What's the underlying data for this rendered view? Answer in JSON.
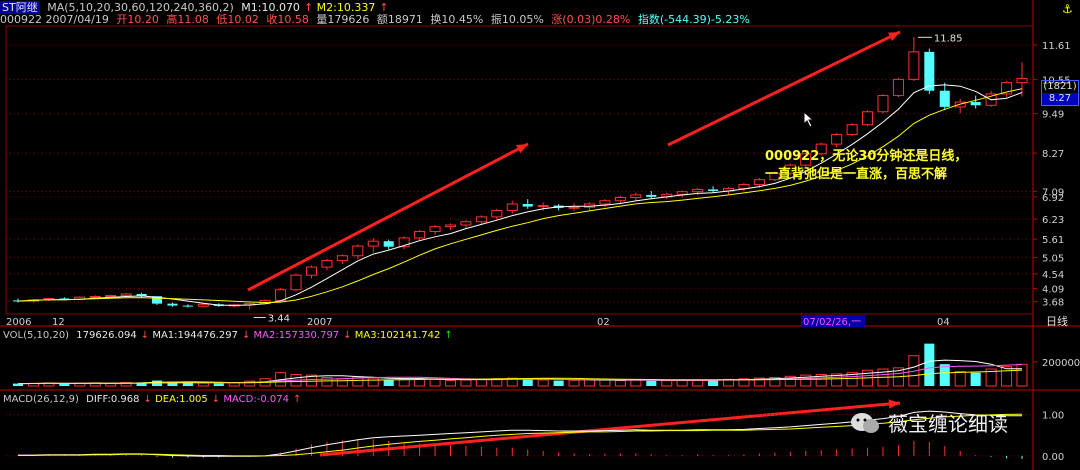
{
  "header": {
    "code": "ST阿继",
    "ma_label": "MA(5,10,20,30,60,120,240,360,2)",
    "m1": "M1:10.070",
    "m2": "M2:10.337",
    "code_date": "000922 2007/04/19",
    "open": "开10.20",
    "high": "高11.08",
    "low": "低10.02",
    "close": "收10.58",
    "vol": "量179626",
    "amount": "额18971",
    "turnover": "换10.45%",
    "amplitude": "振10.05%",
    "change": "涨(0.03)0.28%",
    "index": "指数(-544.39)-5.23%"
  },
  "price_axis": [
    "11.61",
    "10.55",
    "9.49",
    "8.27",
    "7.09",
    "6.92",
    "6.23",
    "5.61",
    "5.05",
    "4.54",
    "4.09",
    "3.68"
  ],
  "price_box": {
    "line1": "(1821)",
    "line2": "8.27"
  },
  "time_axis": {
    "labels": [
      "2006",
      "12",
      "2007",
      "02",
      "07/02/26,一",
      "04"
    ],
    "period": "日线"
  },
  "labels": {
    "high_mark": "11.85",
    "low_mark": "3.44"
  },
  "annotation": {
    "line1": "000922，无论30分钟还是日线，",
    "line2": "一直背弛但是一直涨，百思不解"
  },
  "vol_header": {
    "label": "VOL(5,10,20)",
    "value": "179626.094",
    "ma1": "MA1:194476.297",
    "ma2": "MA2:157330.797",
    "ma3": "MA3:102141.742"
  },
  "vol_axis": [
    "200000"
  ],
  "macd_header": {
    "label": "MACD(26,12,9)",
    "diff": "DIFF:0.968",
    "dea": "DEA:1.005",
    "macd": "MACD:-0.074"
  },
  "macd_axis": [
    "1.00",
    "0.00"
  ],
  "watermark": "薇宝缠论细读",
  "colors": {
    "up": "#ff3030",
    "down": "#55ffff",
    "ma1": "#ffffff",
    "ma2": "#ffff00",
    "ma3": "#ff55ff",
    "arrow": "#ff2020",
    "grid": "#8b0000"
  },
  "chart_data": {
    "type": "candlestick",
    "title": "",
    "ylim": [
      3.3,
      12.2
    ],
    "candles": [
      [
        3.72,
        3.78,
        3.66,
        3.7
      ],
      [
        3.7,
        3.76,
        3.65,
        3.74
      ],
      [
        3.74,
        3.8,
        3.7,
        3.78
      ],
      [
        3.78,
        3.82,
        3.72,
        3.75
      ],
      [
        3.75,
        3.85,
        3.73,
        3.82
      ],
      [
        3.82,
        3.88,
        3.78,
        3.84
      ],
      [
        3.84,
        3.9,
        3.8,
        3.87
      ],
      [
        3.87,
        3.95,
        3.84,
        3.92
      ],
      [
        3.92,
        3.96,
        3.82,
        3.85
      ],
      [
        3.85,
        3.8,
        3.58,
        3.62
      ],
      [
        3.62,
        3.66,
        3.52,
        3.56
      ],
      [
        3.56,
        3.6,
        3.5,
        3.54
      ],
      [
        3.54,
        3.62,
        3.52,
        3.6
      ],
      [
        3.6,
        3.63,
        3.52,
        3.55
      ],
      [
        3.55,
        3.62,
        3.5,
        3.58
      ],
      [
        3.58,
        3.64,
        3.44,
        3.62
      ],
      [
        3.62,
        3.75,
        3.6,
        3.72
      ],
      [
        3.72,
        4.1,
        3.7,
        4.05
      ],
      [
        4.05,
        4.55,
        4.0,
        4.5
      ],
      [
        4.5,
        4.8,
        4.4,
        4.75
      ],
      [
        4.75,
        5.0,
        4.65,
        4.95
      ],
      [
        4.95,
        5.15,
        4.85,
        5.1
      ],
      [
        5.1,
        5.45,
        5.0,
        5.4
      ],
      [
        5.4,
        5.65,
        5.2,
        5.55
      ],
      [
        5.55,
        5.6,
        5.3,
        5.38
      ],
      [
        5.38,
        5.7,
        5.3,
        5.65
      ],
      [
        5.65,
        5.9,
        5.55,
        5.85
      ],
      [
        5.85,
        6.05,
        5.75,
        6.0
      ],
      [
        6.0,
        6.1,
        5.9,
        6.05
      ],
      [
        6.05,
        6.2,
        5.95,
        6.15
      ],
      [
        6.15,
        6.35,
        6.05,
        6.3
      ],
      [
        6.3,
        6.55,
        6.2,
        6.5
      ],
      [
        6.5,
        6.8,
        6.4,
        6.7
      ],
      [
        6.7,
        6.85,
        6.55,
        6.62
      ],
      [
        6.62,
        6.75,
        6.5,
        6.65
      ],
      [
        6.65,
        6.7,
        6.5,
        6.58
      ],
      [
        6.58,
        6.72,
        6.48,
        6.6
      ],
      [
        6.6,
        6.75,
        6.5,
        6.7
      ],
      [
        6.7,
        6.85,
        6.6,
        6.8
      ],
      [
        6.8,
        6.95,
        6.7,
        6.9
      ],
      [
        6.9,
        7.05,
        6.8,
        6.98
      ],
      [
        6.98,
        7.1,
        6.85,
        6.92
      ],
      [
        6.92,
        7.05,
        6.85,
        7.0
      ],
      [
        7.0,
        7.12,
        6.9,
        7.08
      ],
      [
        7.08,
        7.2,
        6.98,
        7.15
      ],
      [
        7.15,
        7.25,
        7.05,
        7.1
      ],
      [
        7.1,
        7.22,
        7.0,
        7.18
      ],
      [
        7.18,
        7.35,
        7.1,
        7.3
      ],
      [
        7.3,
        7.5,
        7.2,
        7.45
      ],
      [
        7.45,
        7.7,
        7.4,
        7.65
      ],
      [
        7.65,
        7.95,
        7.6,
        7.9
      ],
      [
        7.9,
        8.3,
        7.85,
        8.25
      ],
      [
        8.25,
        8.6,
        8.2,
        8.55
      ],
      [
        8.55,
        8.9,
        8.45,
        8.85
      ],
      [
        8.85,
        9.2,
        8.8,
        9.15
      ],
      [
        9.15,
        9.6,
        9.1,
        9.55
      ],
      [
        9.55,
        10.1,
        9.5,
        10.05
      ],
      [
        10.05,
        10.6,
        10.0,
        10.55
      ],
      [
        10.55,
        11.85,
        10.5,
        11.4
      ],
      [
        11.4,
        11.5,
        10.1,
        10.2
      ],
      [
        10.2,
        10.45,
        9.6,
        9.7
      ],
      [
        9.7,
        9.95,
        9.5,
        9.85
      ],
      [
        9.85,
        10.05,
        9.65,
        9.75
      ],
      [
        9.75,
        10.2,
        9.7,
        10.1
      ],
      [
        10.1,
        10.5,
        10.0,
        10.45
      ],
      [
        10.45,
        11.08,
        10.02,
        10.58
      ]
    ],
    "volume": [
      20000,
      22000,
      25000,
      18000,
      24000,
      26000,
      22000,
      28000,
      30000,
      45000,
      35000,
      30000,
      25000,
      22000,
      28000,
      40000,
      60000,
      110000,
      95000,
      90000,
      70000,
      60000,
      75000,
      65000,
      50000,
      55000,
      60000,
      55000,
      45000,
      50000,
      55000,
      60000,
      65000,
      55000,
      50000,
      45000,
      48000,
      55000,
      50000,
      45000,
      48000,
      42000,
      45000,
      50000,
      48000,
      52000,
      55000,
      60000,
      65000,
      70000,
      80000,
      90000,
      95000,
      100000,
      110000,
      130000,
      140000,
      150000,
      250000,
      350000,
      180000,
      120000,
      110000,
      140000,
      160000,
      179626
    ],
    "macd_diff": [
      0.02,
      0.02,
      0.03,
      0.03,
      0.03,
      0.04,
      0.04,
      0.05,
      0.05,
      0.03,
      0.01,
      0.0,
      -0.01,
      -0.01,
      -0.01,
      -0.01,
      0.0,
      0.05,
      0.12,
      0.2,
      0.27,
      0.33,
      0.39,
      0.44,
      0.46,
      0.48,
      0.5,
      0.52,
      0.54,
      0.56,
      0.58,
      0.6,
      0.62,
      0.62,
      0.61,
      0.6,
      0.6,
      0.6,
      0.61,
      0.62,
      0.63,
      0.62,
      0.62,
      0.62,
      0.63,
      0.63,
      0.63,
      0.64,
      0.66,
      0.68,
      0.7,
      0.73,
      0.76,
      0.79,
      0.82,
      0.86,
      0.9,
      0.95,
      1.05,
      1.08,
      1.06,
      1.02,
      0.99,
      0.98,
      0.97,
      0.968
    ],
    "macd_dea": [
      0.01,
      0.01,
      0.02,
      0.02,
      0.02,
      0.03,
      0.03,
      0.04,
      0.04,
      0.04,
      0.03,
      0.02,
      0.01,
      0.01,
      0.0,
      0.0,
      0.0,
      0.01,
      0.03,
      0.06,
      0.1,
      0.14,
      0.19,
      0.24,
      0.28,
      0.32,
      0.35,
      0.38,
      0.41,
      0.44,
      0.47,
      0.5,
      0.52,
      0.54,
      0.55,
      0.56,
      0.57,
      0.58,
      0.58,
      0.59,
      0.6,
      0.6,
      0.61,
      0.61,
      0.61,
      0.62,
      0.62,
      0.62,
      0.63,
      0.64,
      0.65,
      0.67,
      0.69,
      0.71,
      0.73,
      0.76,
      0.79,
      0.82,
      0.87,
      0.91,
      0.94,
      0.96,
      0.98,
      0.99,
      1.0,
      1.005
    ]
  }
}
